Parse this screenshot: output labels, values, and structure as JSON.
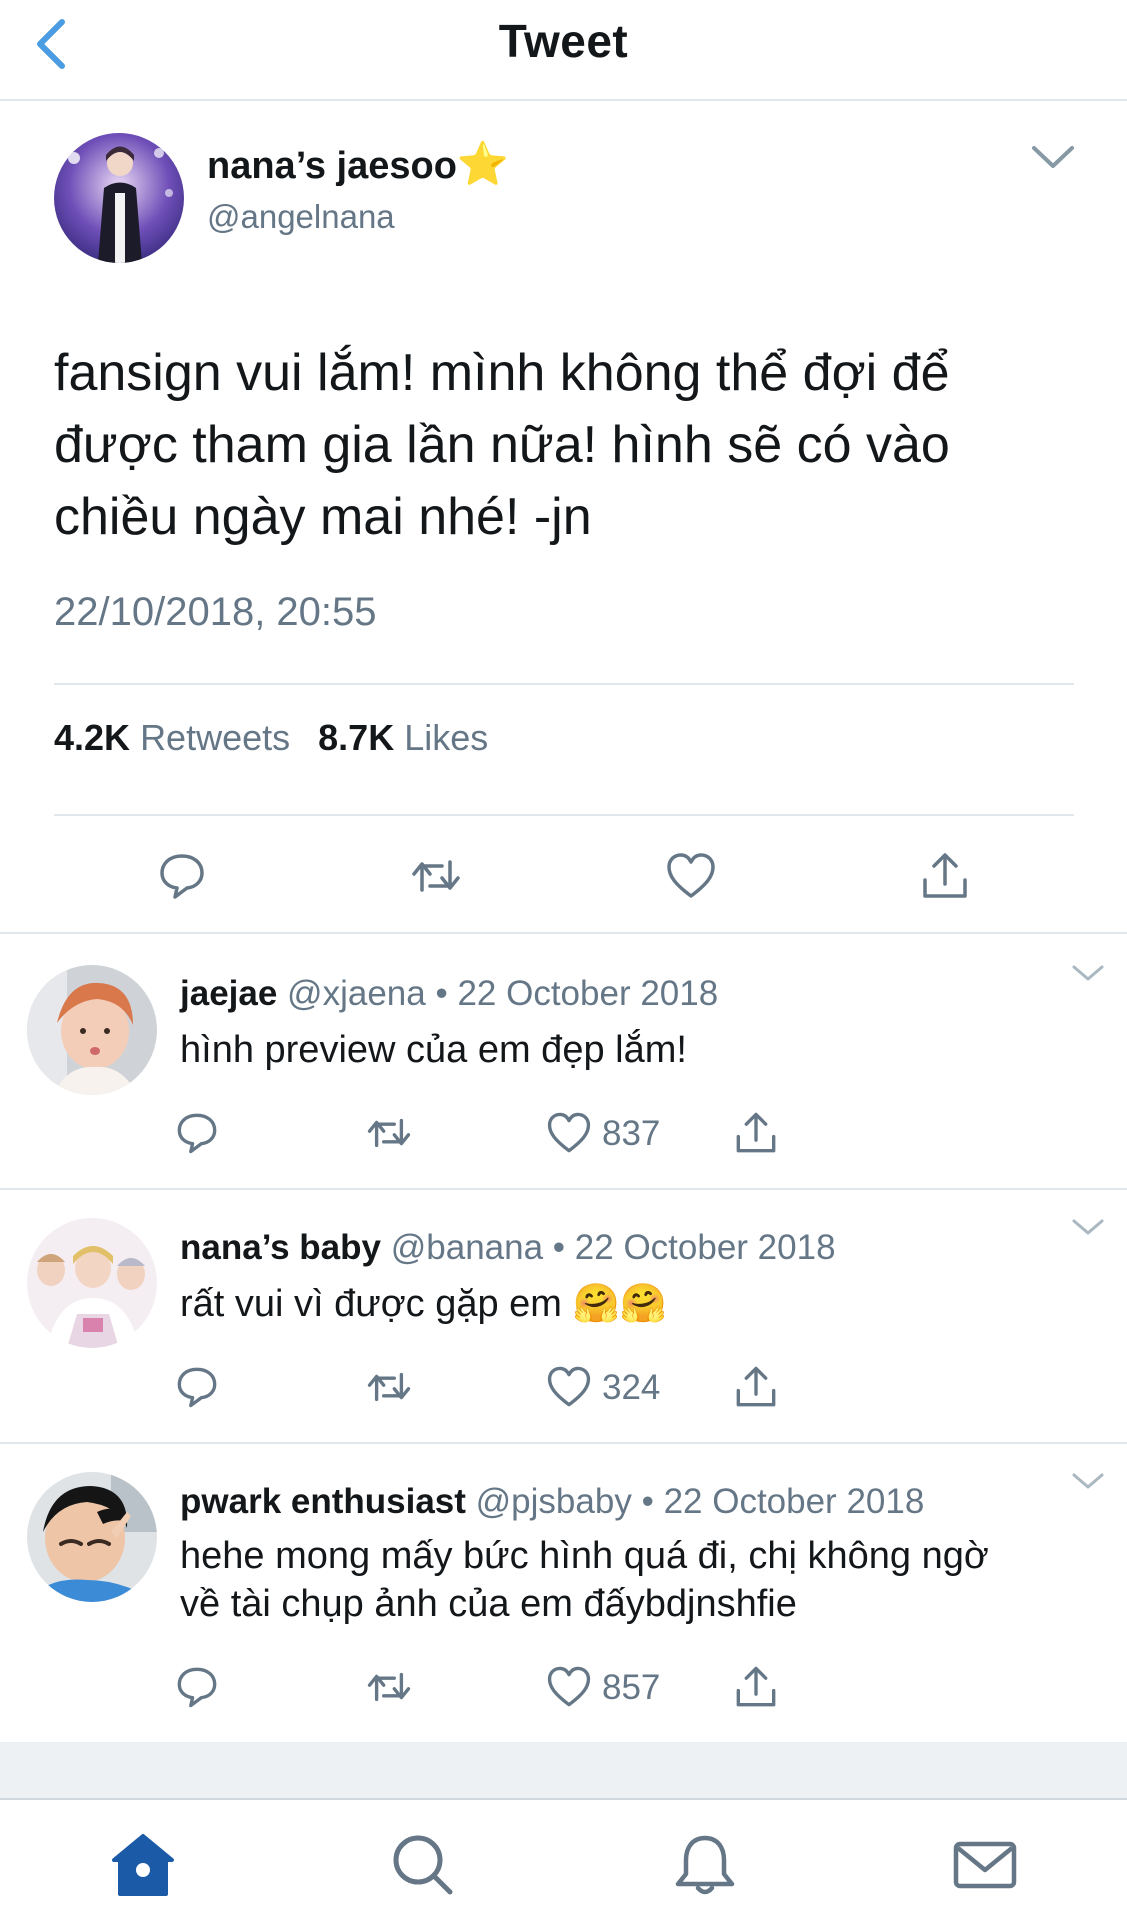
{
  "header": {
    "title": "Tweet"
  },
  "main_tweet": {
    "name": "nana’s jaesoo",
    "name_emoji": "⭐",
    "handle": "@angelnana",
    "text_lines": [
      "fansign vui lắm! mình không thể đợi để",
      "được tham gia lần nữa! hình sẽ có vào",
      "chiều ngày mai nhé! -jn"
    ],
    "date": "22/10/2018, 20:55",
    "retweets_count": "4.2K",
    "retweets_label": "Retweets",
    "likes_count": "8.7K",
    "likes_label": "Likes"
  },
  "replies": [
    {
      "name": "jaejae",
      "handle": "@xjaena",
      "date": "22 October 2018",
      "separator": "•",
      "text_lines": [
        "hình preview của em đẹp lắm!"
      ],
      "likes": "837"
    },
    {
      "name": "nana’s baby",
      "handle": "@banana",
      "date": "22 October 2018",
      "separator": "•",
      "text_lines": [
        "rất vui vì được gặp em 🤗🤗"
      ],
      "likes": "324"
    },
    {
      "name": "pwark enthusiast",
      "handle": "@pjsbaby",
      "date": "22 October 2018",
      "separator": "•",
      "text_lines": [
        "hehe mong mấy bức hình quá đi, chị không ngờ",
        "về tài chụp ảnh của em đấybdjnshfie"
      ],
      "likes": "857"
    }
  ],
  "colors": {
    "accent": "#1da1f2",
    "secondary_text": "#657786",
    "divider": "#e1e8ed",
    "icon": "#657786",
    "home_tab": "#1b5aa6"
  },
  "icons": {
    "back": "chevron-left-icon",
    "caret": "chevron-down-icon",
    "reply": "reply-icon",
    "retweet": "retweet-icon",
    "like": "heart-icon",
    "share": "share-icon",
    "tab_home": "home-icon",
    "tab_search": "search-icon",
    "tab_notifications": "bell-icon",
    "tab_messages": "mail-icon"
  }
}
